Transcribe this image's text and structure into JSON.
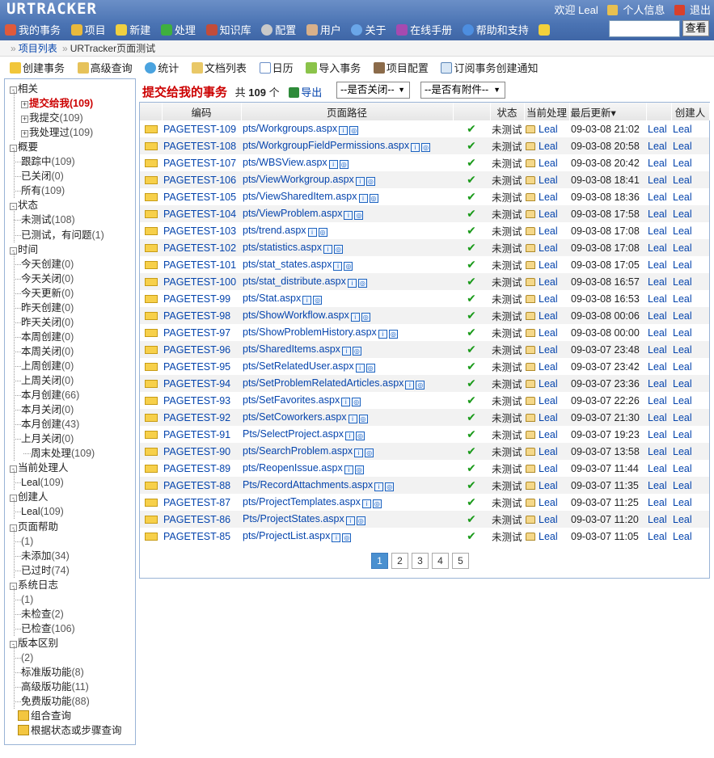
{
  "header": {
    "brand": "URTRACKER",
    "welcome": "欢迎 Leal",
    "profile": "个人信息",
    "logout": "退出",
    "nav": [
      "我的事务",
      "项目",
      "新建",
      "处理",
      "知识库",
      "配置",
      "用户",
      "关于",
      "在线手册",
      "帮助和支持"
    ],
    "search_button": "查看",
    "search_value": ""
  },
  "breadcrumb": [
    "项目列表",
    "URTracker页面测试"
  ],
  "toolbar": [
    "创建事务",
    "高级查询",
    "统计",
    "文档列表",
    "日历",
    "导入事务",
    "项目配置",
    "订阅事务创建通知"
  ],
  "sidebar": [
    {
      "label": "相关",
      "count": "",
      "level": 0,
      "pm": "-"
    },
    {
      "label": "提交给我",
      "count": "(109)",
      "level": 1,
      "pm": "+",
      "hot": true
    },
    {
      "label": "我提交",
      "count": "(109)",
      "level": 1,
      "pm": "+"
    },
    {
      "label": "我处理过",
      "count": "(109)",
      "level": 1,
      "pm": "+"
    },
    {
      "label": "概要",
      "count": "",
      "level": 0,
      "pm": "-"
    },
    {
      "label": "跟踪中",
      "count": "(109)",
      "level": 1
    },
    {
      "label": "已关闭",
      "count": "(0)",
      "level": 1
    },
    {
      "label": "所有",
      "count": "(109)",
      "level": 1
    },
    {
      "label": "状态",
      "count": "",
      "level": 0,
      "pm": "-"
    },
    {
      "label": "未测试",
      "count": "(108)",
      "level": 1
    },
    {
      "label": "已测试，有问题",
      "count": "(1)",
      "level": 1
    },
    {
      "label": "时间",
      "count": "",
      "level": 0,
      "pm": "-"
    },
    {
      "label": "今天创建",
      "count": "(0)",
      "level": 1
    },
    {
      "label": "今天关闭",
      "count": "(0)",
      "level": 1
    },
    {
      "label": "今天更新",
      "count": "(0)",
      "level": 1
    },
    {
      "label": "昨天创建",
      "count": "(0)",
      "level": 1
    },
    {
      "label": "昨天关闭",
      "count": "(0)",
      "level": 1
    },
    {
      "label": "本周创建",
      "count": "(0)",
      "level": 1
    },
    {
      "label": "本周关闭",
      "count": "(0)",
      "level": 1
    },
    {
      "label": "上周创建",
      "count": "(0)",
      "level": 1
    },
    {
      "label": "上周关闭",
      "count": "(0)",
      "level": 1
    },
    {
      "label": "本月创建",
      "count": "(66)",
      "level": 1
    },
    {
      "label": "本月关闭",
      "count": "(0)",
      "level": 1
    },
    {
      "label": "本月创建",
      "count": "(43)",
      "level": 1
    },
    {
      "label": "上月关闭",
      "count": "(0)",
      "level": 1
    },
    {
      "label": "周末处理",
      "count": "(109)",
      "level": 2
    },
    {
      "label": "当前处理人",
      "count": "",
      "level": 0,
      "pm": "-"
    },
    {
      "label": "Leal",
      "count": "(109)",
      "level": 1
    },
    {
      "label": "创建人",
      "count": "",
      "level": 0,
      "pm": "-"
    },
    {
      "label": "Leal",
      "count": "(109)",
      "level": 1
    },
    {
      "label": "页面帮助",
      "count": "",
      "level": 0,
      "pm": "-"
    },
    {
      "label": "",
      "count": "(1)",
      "level": 1
    },
    {
      "label": "未添加",
      "count": "(34)",
      "level": 1
    },
    {
      "label": "已过时",
      "count": "(74)",
      "level": 1
    },
    {
      "label": "系统日志",
      "count": "",
      "level": 0,
      "pm": "-"
    },
    {
      "label": "",
      "count": "(1)",
      "level": 1
    },
    {
      "label": "未检查",
      "count": "(2)",
      "level": 1
    },
    {
      "label": "已检查",
      "count": "(106)",
      "level": 1
    },
    {
      "label": "版本区别",
      "count": "",
      "level": 0,
      "pm": "-"
    },
    {
      "label": "",
      "count": "(2)",
      "level": 1
    },
    {
      "label": "标准版功能",
      "count": "(8)",
      "level": 1
    },
    {
      "label": "高级版功能",
      "count": "(11)",
      "level": 1
    },
    {
      "label": "免费版功能",
      "count": "(88)",
      "level": 1
    },
    {
      "label": "组合查询",
      "count": "",
      "level": 0,
      "query": true
    },
    {
      "label": "根据状态或步骤查询",
      "count": "",
      "level": 0,
      "query": true
    }
  ],
  "list": {
    "title": "提交给我的事务",
    "total_prefix": "共",
    "total": "109",
    "total_suffix": "个",
    "export": "导出",
    "filter_closed": "--是否关闭--",
    "filter_attach": "--是否有附件--",
    "columns": [
      "编码",
      "页面路径",
      "状态",
      "当前处理",
      "最后更新▾",
      "创建人"
    ],
    "rows": [
      {
        "code": "PAGETEST-109",
        "path": "pts/Workgroups.aspx",
        "status": "未测试",
        "handler": "Leal",
        "updated": "09-03-08 21:02",
        "updater": "Leal",
        "creator": "Leal"
      },
      {
        "code": "PAGETEST-108",
        "path": "pts/WorkgroupFieldPermissions.aspx",
        "status": "未测试",
        "handler": "Leal",
        "updated": "09-03-08 20:58",
        "updater": "Leal",
        "creator": "Leal"
      },
      {
        "code": "PAGETEST-107",
        "path": "pts/WBSView.aspx",
        "status": "未测试",
        "handler": "Leal",
        "updated": "09-03-08 20:42",
        "updater": "Leal",
        "creator": "Leal"
      },
      {
        "code": "PAGETEST-106",
        "path": "pts/ViewWorkgroup.aspx",
        "status": "未测试",
        "handler": "Leal",
        "updated": "09-03-08 18:41",
        "updater": "Leal",
        "creator": "Leal"
      },
      {
        "code": "PAGETEST-105",
        "path": "pts/ViewSharedItem.aspx",
        "status": "未测试",
        "handler": "Leal",
        "updated": "09-03-08 18:36",
        "updater": "Leal",
        "creator": "Leal"
      },
      {
        "code": "PAGETEST-104",
        "path": "pts/ViewProblem.aspx",
        "status": "未测试",
        "handler": "Leal",
        "updated": "09-03-08 17:58",
        "updater": "Leal",
        "creator": "Leal"
      },
      {
        "code": "PAGETEST-103",
        "path": "pts/trend.aspx",
        "status": "未测试",
        "handler": "Leal",
        "updated": "09-03-08 17:08",
        "updater": "Leal",
        "creator": "Leal"
      },
      {
        "code": "PAGETEST-102",
        "path": "pts/statistics.aspx",
        "status": "未测试",
        "handler": "Leal",
        "updated": "09-03-08 17:08",
        "updater": "Leal",
        "creator": "Leal"
      },
      {
        "code": "PAGETEST-101",
        "path": "pts/stat_states.aspx",
        "status": "未测试",
        "handler": "Leal",
        "updated": "09-03-08 17:05",
        "updater": "Leal",
        "creator": "Leal"
      },
      {
        "code": "PAGETEST-100",
        "path": "pts/stat_distribute.aspx",
        "status": "未测试",
        "handler": "Leal",
        "updated": "09-03-08 16:57",
        "updater": "Leal",
        "creator": "Leal"
      },
      {
        "code": "PAGETEST-99",
        "path": "pts/Stat.aspx",
        "status": "未测试",
        "handler": "Leal",
        "updated": "09-03-08 16:53",
        "updater": "Leal",
        "creator": "Leal"
      },
      {
        "code": "PAGETEST-98",
        "path": "pts/ShowWorkflow.aspx",
        "status": "未测试",
        "handler": "Leal",
        "updated": "09-03-08 00:06",
        "updater": "Leal",
        "creator": "Leal"
      },
      {
        "code": "PAGETEST-97",
        "path": "pts/ShowProblemHistory.aspx",
        "status": "未测试",
        "handler": "Leal",
        "updated": "09-03-08 00:00",
        "updater": "Leal",
        "creator": "Leal"
      },
      {
        "code": "PAGETEST-96",
        "path": "pts/SharedItems.aspx",
        "status": "未测试",
        "handler": "Leal",
        "updated": "09-03-07 23:48",
        "updater": "Leal",
        "creator": "Leal"
      },
      {
        "code": "PAGETEST-95",
        "path": "pts/SetRelatedUser.aspx",
        "status": "未测试",
        "handler": "Leal",
        "updated": "09-03-07 23:42",
        "updater": "Leal",
        "creator": "Leal"
      },
      {
        "code": "PAGETEST-94",
        "path": "pts/SetProblemRelatedArticles.aspx",
        "status": "未测试",
        "handler": "Leal",
        "updated": "09-03-07 23:36",
        "updater": "Leal",
        "creator": "Leal"
      },
      {
        "code": "PAGETEST-93",
        "path": "pts/SetFavorites.aspx",
        "status": "未测试",
        "handler": "Leal",
        "updated": "09-03-07 22:26",
        "updater": "Leal",
        "creator": "Leal"
      },
      {
        "code": "PAGETEST-92",
        "path": "pts/SetCoworkers.aspx",
        "status": "未测试",
        "handler": "Leal",
        "updated": "09-03-07 21:30",
        "updater": "Leal",
        "creator": "Leal"
      },
      {
        "code": "PAGETEST-91",
        "path": "Pts/SelectProject.aspx",
        "status": "未测试",
        "handler": "Leal",
        "updated": "09-03-07 19:23",
        "updater": "Leal",
        "creator": "Leal"
      },
      {
        "code": "PAGETEST-90",
        "path": "pts/SearchProblem.aspx",
        "status": "未测试",
        "handler": "Leal",
        "updated": "09-03-07 13:58",
        "updater": "Leal",
        "creator": "Leal"
      },
      {
        "code": "PAGETEST-89",
        "path": "pts/ReopenIssue.aspx",
        "status": "未测试",
        "handler": "Leal",
        "updated": "09-03-07 11:44",
        "updater": "Leal",
        "creator": "Leal"
      },
      {
        "code": "PAGETEST-88",
        "path": "Pts/RecordAttachments.aspx",
        "status": "未测试",
        "handler": "Leal",
        "updated": "09-03-07 11:35",
        "updater": "Leal",
        "creator": "Leal"
      },
      {
        "code": "PAGETEST-87",
        "path": "pts/ProjectTemplates.aspx",
        "status": "未测试",
        "handler": "Leal",
        "updated": "09-03-07 11:25",
        "updater": "Leal",
        "creator": "Leal"
      },
      {
        "code": "PAGETEST-86",
        "path": "Pts/ProjectStates.aspx",
        "status": "未测试",
        "handler": "Leal",
        "updated": "09-03-07 11:20",
        "updater": "Leal",
        "creator": "Leal"
      },
      {
        "code": "PAGETEST-85",
        "path": "pts/ProjectList.aspx",
        "status": "未测试",
        "handler": "Leal",
        "updated": "09-03-07 11:05",
        "updater": "Leal",
        "creator": "Leal"
      }
    ],
    "pages": [
      "1",
      "2",
      "3",
      "4",
      "5"
    ],
    "active_page": "1"
  }
}
